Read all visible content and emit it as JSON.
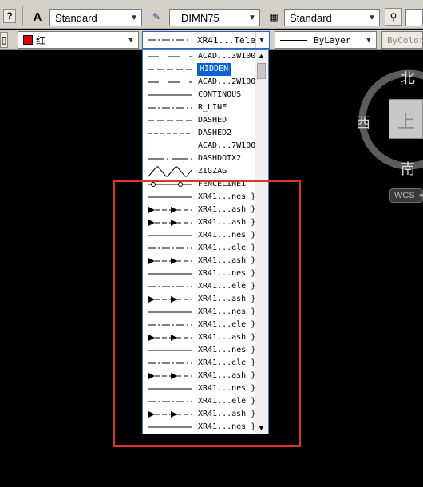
{
  "toolbar1": {
    "text_style": "Standard",
    "dim_style": "DIMN75",
    "table_style": "Standard"
  },
  "toolbar2": {
    "color_name": "红",
    "linetype_value": "XR41...Tele",
    "lineweight_value": "ByLayer",
    "plotstyle_value": "ByColor"
  },
  "linetype_dropdown": {
    "items": [
      {
        "name": "ACAD...3W100",
        "pattern": "dash-long"
      },
      {
        "name": "HIDDEN",
        "pattern": "dash-med",
        "selected": true
      },
      {
        "name": "ACAD...2W100",
        "pattern": "dash-long"
      },
      {
        "name": "CONTINOUS",
        "pattern": "solid"
      },
      {
        "name": "R_LINE",
        "pattern": "dash-dot"
      },
      {
        "name": "DASHED",
        "pattern": "dash-med"
      },
      {
        "name": "DASHED2",
        "pattern": "dash-short"
      },
      {
        "name": "ACAD...7W100",
        "pattern": "dots"
      },
      {
        "name": "DASHDOTX2",
        "pattern": "dash-dot-long"
      },
      {
        "name": "ZIGZAG",
        "pattern": "zigzag"
      },
      {
        "name": "FENCELINE1",
        "pattern": "fence"
      },
      {
        "name": "XR41...nes }",
        "pattern": "solid"
      },
      {
        "name": "XR41...ash }",
        "pattern": "arrow-dash"
      },
      {
        "name": "XR41...ash }",
        "pattern": "arrow-dash"
      },
      {
        "name": "XR41...nes }",
        "pattern": "solid"
      },
      {
        "name": "XR41...ele }",
        "pattern": "dash-dot"
      },
      {
        "name": "XR41...ash }",
        "pattern": "arrow-dash"
      },
      {
        "name": "XR41...nes }",
        "pattern": "solid"
      },
      {
        "name": "XR41...ele }",
        "pattern": "dash-dot"
      },
      {
        "name": "XR41...ash }",
        "pattern": "arrow-dash"
      },
      {
        "name": "XR41...nes }",
        "pattern": "solid"
      },
      {
        "name": "XR41...ele }",
        "pattern": "dash-dot"
      },
      {
        "name": "XR41...ash }",
        "pattern": "arrow-dash"
      },
      {
        "name": "XR41...nes }",
        "pattern": "solid"
      },
      {
        "name": "XR41...ele }",
        "pattern": "dash-dot"
      },
      {
        "name": "XR41...ash }",
        "pattern": "arrow-dash"
      },
      {
        "name": "XR41...nes }",
        "pattern": "solid"
      },
      {
        "name": "XR41...ele }",
        "pattern": "dash-dot"
      },
      {
        "name": "XR41...ash }",
        "pattern": "arrow-dash"
      },
      {
        "name": "XR41...nes }",
        "pattern": "solid"
      }
    ]
  },
  "viewcube": {
    "north": "北",
    "west": "西",
    "south": "南",
    "face": "上",
    "wcs": "WCS"
  },
  "colors": {
    "canvas": "#000000",
    "highlight_rect": "#e03030",
    "selection": "#0a63d4",
    "color_swatch": "#e00000"
  }
}
